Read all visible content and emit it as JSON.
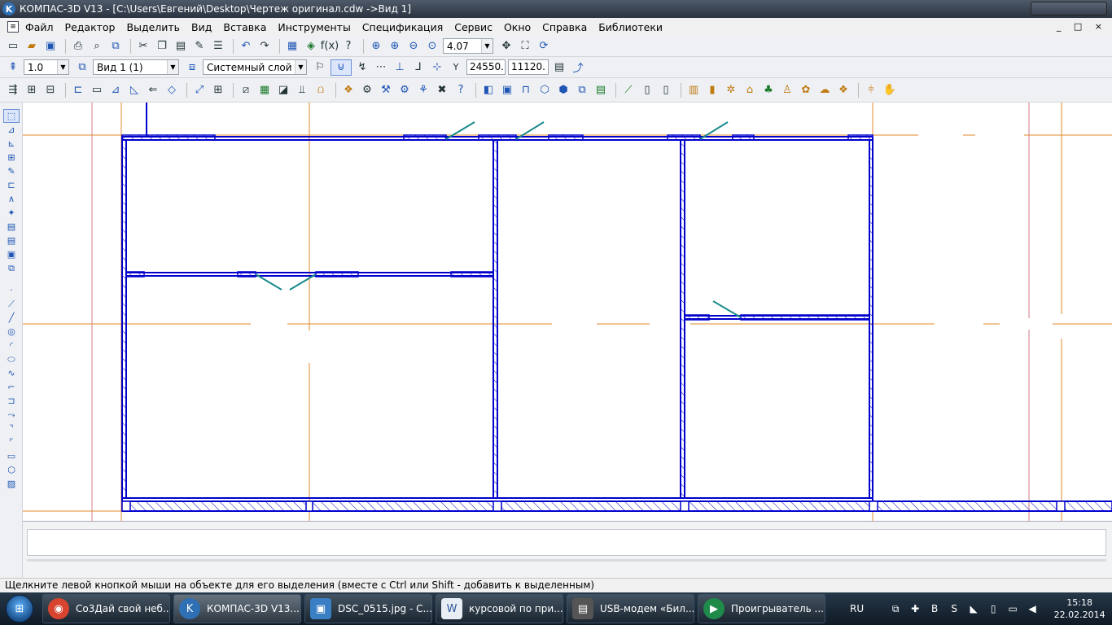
{
  "window": {
    "title": "КОМПАС-3D V13 - [C:\\Users\\Евгений\\Desktop\\Чертеж оригинал.cdw ->Вид 1]",
    "app_icon_letter": "K",
    "mdi_controls": "_ □ ×"
  },
  "menu": [
    "Файл",
    "Редактор",
    "Выделить",
    "Вид",
    "Вставка",
    "Инструменты",
    "Спецификация",
    "Сервис",
    "Окно",
    "Справка",
    "Библиотеки"
  ],
  "toolbar1": {
    "zoom_value": "4.07"
  },
  "toolbar2": {
    "step_value": "1.0",
    "view_value": "Вид 1 (1)",
    "layer_value": "Системный слой (",
    "coord_x": "24550.",
    "coord_y": "11120.",
    "coord_label": "Y"
  },
  "drawing": {
    "wall_color": "#0000cc",
    "axis_color": "#e08a2a",
    "door_color": "#1a8a8a",
    "aux_color": "#d47a8a"
  },
  "status_text": "Щелкните левой кнопкой мыши на объекте для его выделения (вместе с Ctrl или Shift - добавить к выделенным)",
  "taskbar": {
    "start_label": "⊞",
    "tasks": [
      {
        "label": "Со3Дай свой неб...",
        "icon": "chrome-icon",
        "color": "#d8442f"
      },
      {
        "label": "КОМПАС-3D V13...",
        "icon": "kompas-icon",
        "color": "#2f6fb3"
      },
      {
        "label": "DSC_0515.jpg - С...",
        "icon": "photo-viewer-icon",
        "color": "#3a7fc4"
      },
      {
        "label": "курсовой по при...",
        "icon": "word-icon",
        "color": "#e9eef5"
      },
      {
        "label": "USB-модем «Бил...",
        "icon": "modem-icon",
        "color": "#555"
      },
      {
        "label": "Проигрыватель ...",
        "icon": "media-player-icon",
        "color": "#1f8a4a"
      }
    ],
    "lang": "RU",
    "time": "15:18",
    "date": "22.02.2014"
  }
}
